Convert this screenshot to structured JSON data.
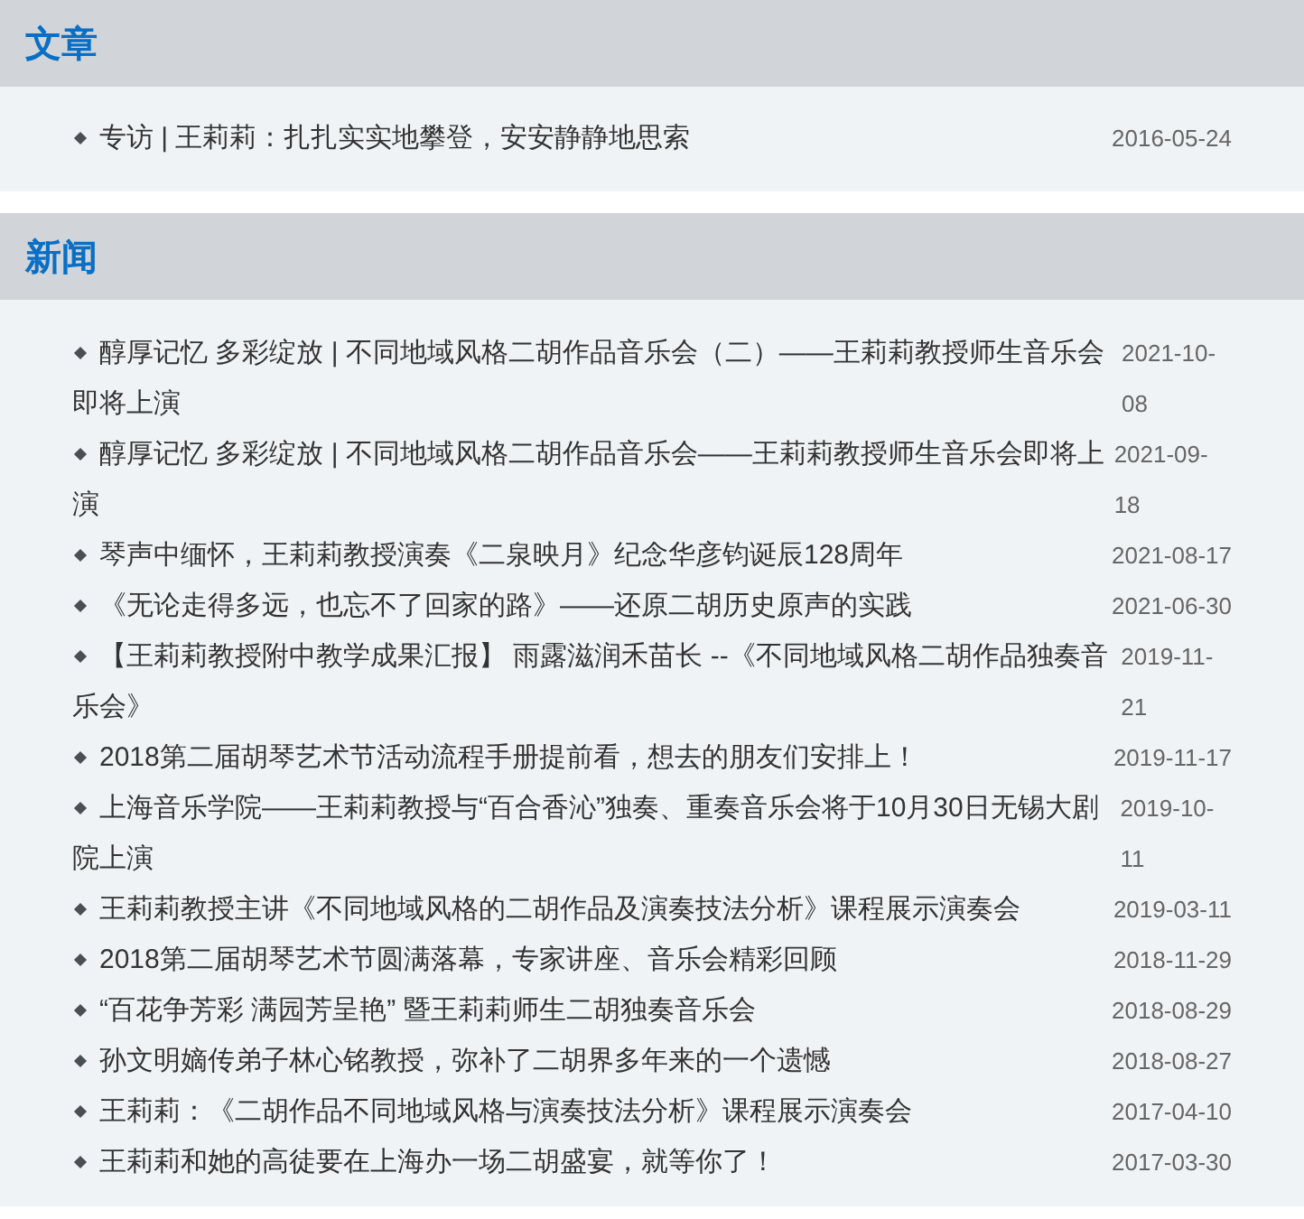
{
  "sections": [
    {
      "title": "文章",
      "items": [
        {
          "title": "专访 | 王莉莉：扎扎实实地攀登，安安静静地思索",
          "date": "2016-05-24"
        }
      ]
    },
    {
      "title": "新闻",
      "items": [
        {
          "title": "醇厚记忆 多彩绽放 | 不同地域风格二胡作品音乐会（二）——王莉莉教授师生音乐会即将上演",
          "date": "2021-10-08"
        },
        {
          "title": "醇厚记忆 多彩绽放 | 不同地域风格二胡作品音乐会——王莉莉教授师生音乐会即将上演",
          "date": "2021-09-18"
        },
        {
          "title": "琴声中缅怀，王莉莉教授演奏《二泉映月》纪念华彦钧诞辰128周年",
          "date": "2021-08-17"
        },
        {
          "title": "《无论走得多远，也忘不了回家的路》——还原二胡历史原声的实践",
          "date": "2021-06-30"
        },
        {
          "title": "【王莉莉教授附中教学成果汇报】 雨露滋润禾苗长 --《不同地域风格二胡作品独奏音乐会》",
          "date": "2019-11-21"
        },
        {
          "title": "2018第二届胡琴艺术节活动流程手册提前看，想去的朋友们安排上！",
          "date": "2019-11-17"
        },
        {
          "title": "上海音乐学院——王莉莉教授与“百合香沁”独奏、重奏音乐会将于10月30日无锡大剧院上演",
          "date": "2019-10-11"
        },
        {
          "title": "王莉莉教授主讲《不同地域风格的二胡作品及演奏技法分析》课程展示演奏会",
          "date": "2019-03-11"
        },
        {
          "title": "2018第二届胡琴艺术节圆满落幕，专家讲座、音乐会精彩回顾",
          "date": "2018-11-29"
        },
        {
          "title": "“百花争芳彩 满园芳呈艳” 暨王莉莉师生二胡独奏音乐会",
          "date": "2018-08-29"
        },
        {
          "title": "孙文明嫡传弟子林心铭教授，弥补了二胡界多年来的一个遗憾",
          "date": "2018-08-27"
        },
        {
          "title": "王莉莉：《二胡作品不同地域风格与演奏技法分析》课程展示演奏会",
          "date": "2017-04-10"
        },
        {
          "title": "王莉莉和她的高徒要在上海办一场二胡盛宴，就等你了！",
          "date": "2017-03-30"
        }
      ]
    }
  ]
}
